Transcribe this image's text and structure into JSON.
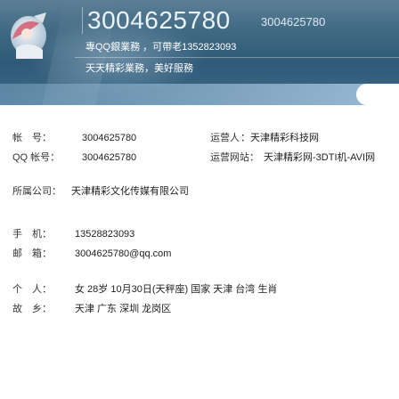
{
  "header": {
    "display_id": "3004625780",
    "small_id": "3004625780",
    "line2": "專QQ銀業務 ，可帶老1352823093",
    "line3": "天天精彩業務，美好服務"
  },
  "profile": {
    "account": {
      "label": "帐　号：",
      "value": "3004625780"
    },
    "qq_account": {
      "label": "QQ 帐号：",
      "value": "3004625780"
    },
    "role": {
      "label": "运营人",
      "value": "：天津精彩科技网"
    },
    "role2": {
      "label": "运营网站：",
      "value": "天津精彩网-3DTI机-AVI网"
    },
    "company": {
      "label": "所属公司：",
      "value": "天津精彩文化传媒有限公司"
    },
    "phone": {
      "label": "手　机：",
      "value": "13528823093"
    },
    "email": {
      "label": "邮　箱：",
      "value": "3004625780@qq.com"
    },
    "intro": {
      "label": "个　人：",
      "value": "女 28岁 10月30日(天秤座) 国家 天津 台湾 生肖"
    },
    "location": {
      "label": "故　乡：",
      "value": "天津 广东 深圳 龙岗区"
    }
  },
  "colors": {
    "banner_top": "#5c7f96",
    "banner_bottom": "#2f5a78",
    "band": "#a9c7dd",
    "text": "#222222"
  },
  "icons": [
    "avatar-image"
  ]
}
